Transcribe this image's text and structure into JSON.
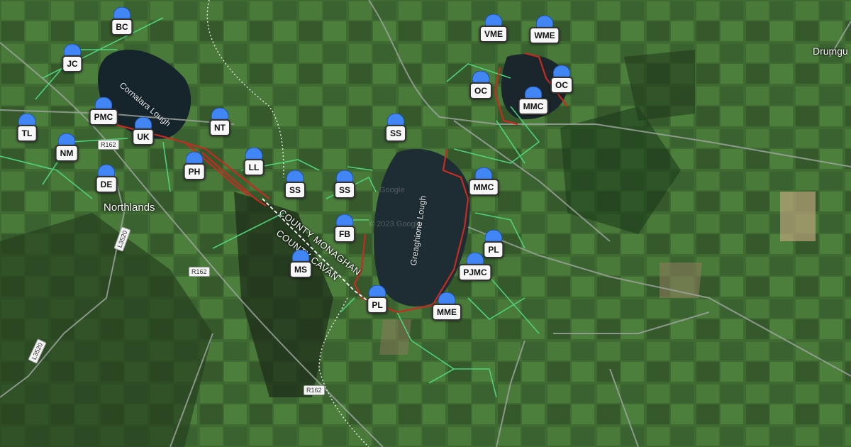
{
  "map": {
    "places": {
      "northlands": "Northlands",
      "drumgu": "Drumgu"
    },
    "lakes": {
      "cornalara": "Cornalara Lough",
      "greaghione": "Greaghione Lough"
    },
    "roads": {
      "r162_a": "R162",
      "r162_b": "R162",
      "r162_c": "R162",
      "l3520_a": "L3520",
      "l3520_b": "L3520"
    },
    "county": {
      "monaghan": "COUNTY MONAGHAN",
      "cavan": "COUNTY CAVAN"
    },
    "watermarks": {
      "w1": "Google",
      "w2": "© 2023 Google"
    },
    "markers": [
      {
        "id": "BC",
        "label": "BC"
      },
      {
        "id": "JC",
        "label": "JC"
      },
      {
        "id": "PMC",
        "label": "PMC"
      },
      {
        "id": "TL",
        "label": "TL"
      },
      {
        "id": "UK",
        "label": "UK"
      },
      {
        "id": "NM",
        "label": "NM"
      },
      {
        "id": "NT",
        "label": "NT"
      },
      {
        "id": "PH",
        "label": "PH"
      },
      {
        "id": "DE",
        "label": "DE"
      },
      {
        "id": "LL",
        "label": "LL"
      },
      {
        "id": "SS1",
        "label": "SS"
      },
      {
        "id": "SS2",
        "label": "SS"
      },
      {
        "id": "SS3",
        "label": "SS"
      },
      {
        "id": "FB",
        "label": "FB"
      },
      {
        "id": "MS",
        "label": "MS"
      },
      {
        "id": "VME",
        "label": "VME"
      },
      {
        "id": "WME",
        "label": "WME"
      },
      {
        "id": "OC1",
        "label": "OC"
      },
      {
        "id": "OC2",
        "label": "OC"
      },
      {
        "id": "MMC1",
        "label": "MMC"
      },
      {
        "id": "MMC2",
        "label": "MMC"
      },
      {
        "id": "PL1",
        "label": "PL"
      },
      {
        "id": "PJMC",
        "label": "PJMC"
      },
      {
        "id": "PL2",
        "label": "PL"
      },
      {
        "id": "MME",
        "label": "MME"
      }
    ],
    "colors": {
      "pin": "#4285f4",
      "boundary_red": "#c62b22",
      "boundary_green": "#4fd17a",
      "county_line": "#ffffff"
    }
  }
}
